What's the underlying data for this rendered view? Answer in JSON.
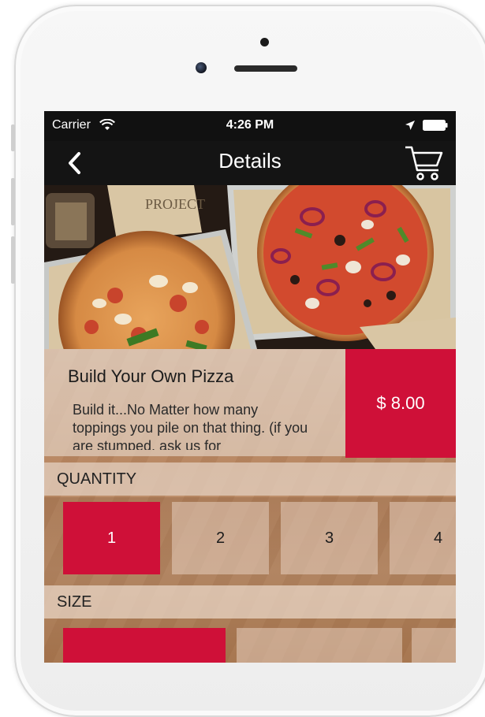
{
  "status_bar": {
    "carrier": "Carrier",
    "time": "4:26 PM"
  },
  "navbar": {
    "title": "Details",
    "back_icon": "chevron-left-icon",
    "cart_icon": "shopping-cart-icon"
  },
  "item": {
    "name": "Build Your Own Pizza",
    "description": "Build it...No Matter how many toppings you pile on that thing. (if you are stumped, ask us for",
    "price": "$ 8.00"
  },
  "quantity": {
    "header": "QUANTITY",
    "options": [
      "1",
      "2",
      "3",
      "4"
    ],
    "selected": "1"
  },
  "size": {
    "header": "SIZE"
  },
  "colors": {
    "accent": "#cf1038",
    "bar": "#141414"
  }
}
